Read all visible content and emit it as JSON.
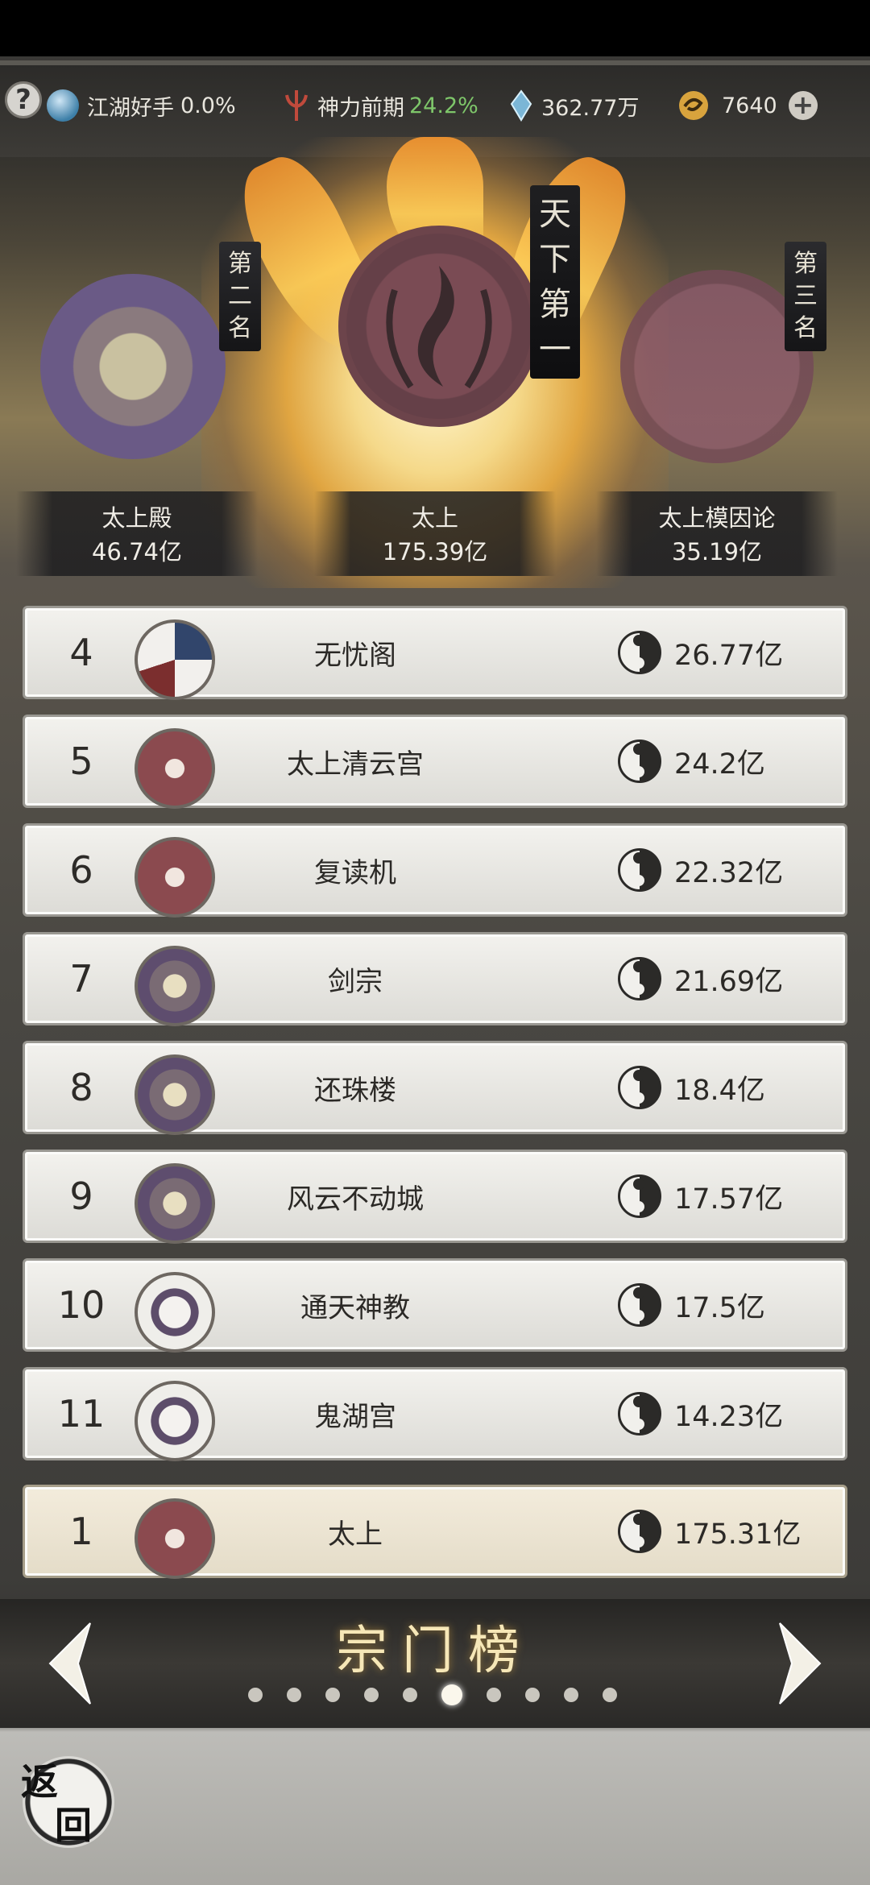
{
  "topbar": {
    "help_icon": "?",
    "realm_label": "江湖好手",
    "realm_value": "0.0%",
    "power_label": "神力前期",
    "power_value": "24.2%",
    "gem_value": "362.77万",
    "coin_value": "7640",
    "plus_icon": "+"
  },
  "podium": {
    "first_tag": "天下第一",
    "second_tag": "第二名",
    "third_tag": "第三名",
    "first": {
      "name": "太上",
      "score": "175.39亿"
    },
    "second": {
      "name": "太上殿",
      "score": "46.74亿"
    },
    "third": {
      "name": "太上模因论",
      "score": "35.19亿"
    }
  },
  "ranking": [
    {
      "rank": "4",
      "name": "无忧阁",
      "score": "26.77亿",
      "badge": "koi-icon"
    },
    {
      "rank": "5",
      "name": "太上清云宫",
      "score": "24.2亿",
      "badge": "flame-crest-icon"
    },
    {
      "rank": "6",
      "name": "复读机",
      "score": "22.32亿",
      "badge": "flame-crest-icon"
    },
    {
      "rank": "7",
      "name": "剑宗",
      "score": "21.69亿",
      "badge": "rose-crest-icon"
    },
    {
      "rank": "8",
      "name": "还珠楼",
      "score": "18.4亿",
      "badge": "rose-crest-icon"
    },
    {
      "rank": "9",
      "name": "风云不动城",
      "score": "17.57亿",
      "badge": "rose-crest-icon"
    },
    {
      "rank": "10",
      "name": "通天神教",
      "score": "17.5亿",
      "badge": "dragon-crest-icon"
    },
    {
      "rank": "11",
      "name": "鬼湖宫",
      "score": "14.23亿",
      "badge": "dragon-crest-icon"
    }
  ],
  "my_rank": {
    "rank": "1",
    "name": "太上",
    "score": "175.31亿",
    "badge": "flame-crest-icon"
  },
  "nav": {
    "title": "宗门榜",
    "page_count": 10,
    "active_page": 6
  },
  "back": {
    "char1": "返",
    "char2": "回"
  }
}
